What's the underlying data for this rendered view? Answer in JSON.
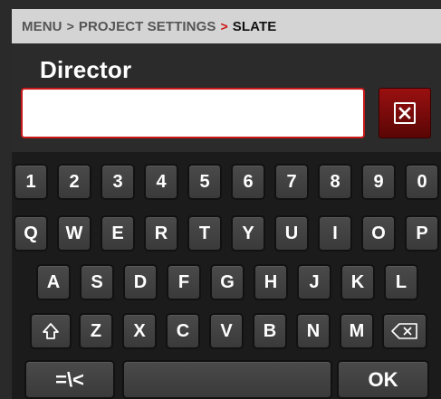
{
  "breadcrumb": {
    "items": [
      "MENU",
      "PROJECT SETTINGS",
      "SLATE"
    ],
    "separator": ">"
  },
  "field": {
    "label": "Director",
    "value": ""
  },
  "clear_button": {
    "icon": "close-box-icon"
  },
  "keyboard": {
    "row1": [
      "1",
      "2",
      "3",
      "4",
      "5",
      "6",
      "7",
      "8",
      "9",
      "0"
    ],
    "row2": [
      "Q",
      "W",
      "E",
      "R",
      "T",
      "Y",
      "U",
      "I",
      "O",
      "P"
    ],
    "row3": [
      "A",
      "S",
      "D",
      "F",
      "G",
      "H",
      "J",
      "K",
      "L"
    ],
    "row4": [
      "Z",
      "X",
      "C",
      "V",
      "B",
      "N",
      "M"
    ],
    "shift_icon": "shift-arrow-icon",
    "backspace_icon": "backspace-icon",
    "symbols_label": "=\\<",
    "space_label": "",
    "ok_label": "OK"
  },
  "colors": {
    "accent_red": "#c81818",
    "key_bg": "#424242",
    "keyboard_bg": "#1b1b1b",
    "breadcrumb_bg": "#d4d4d4"
  }
}
